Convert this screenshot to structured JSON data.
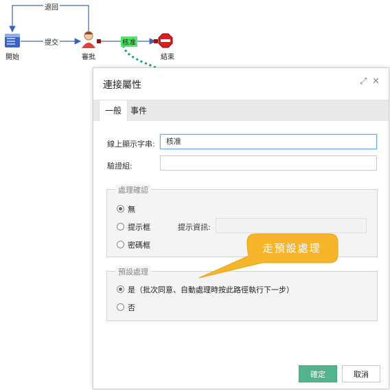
{
  "diagram": {
    "nodes": {
      "start": "開始",
      "approve": "審批",
      "end": "結束"
    },
    "edges": {
      "back": "退回",
      "submit": "提交",
      "approved": "核准"
    }
  },
  "dialog": {
    "title": "連接屬性",
    "tabs": [
      {
        "label": "一般",
        "active": true
      },
      {
        "label": "事件",
        "active": false
      }
    ],
    "display_text": {
      "label": "線上顯示字串:",
      "value": "核准"
    },
    "validation_group": {
      "label": "驗證組:",
      "value": ""
    },
    "confirm_group": {
      "legend": "處理確認",
      "options": [
        {
          "label": "無",
          "selected": true
        },
        {
          "label": "提示框",
          "selected": false
        },
        {
          "label": "密碼框",
          "selected": false
        }
      ],
      "hint_label": "提示資訊:",
      "hint_value": ""
    },
    "default_group": {
      "legend": "預設處理",
      "options": [
        {
          "label": "是（批次同意、自動處理時按此路徑執行下一步）",
          "selected": true
        },
        {
          "label": "否",
          "selected": false
        }
      ]
    },
    "buttons": {
      "ok": "確定",
      "cancel": "取消"
    }
  },
  "callout": {
    "text": "走預設處理"
  },
  "colors": {
    "accent": "#53b38a",
    "callout": "#f7b52c",
    "link_arrow": "#1a9a8a"
  },
  "icons": [
    "expand-icon",
    "close-icon",
    "start-icon",
    "person-icon",
    "stop-icon"
  ]
}
